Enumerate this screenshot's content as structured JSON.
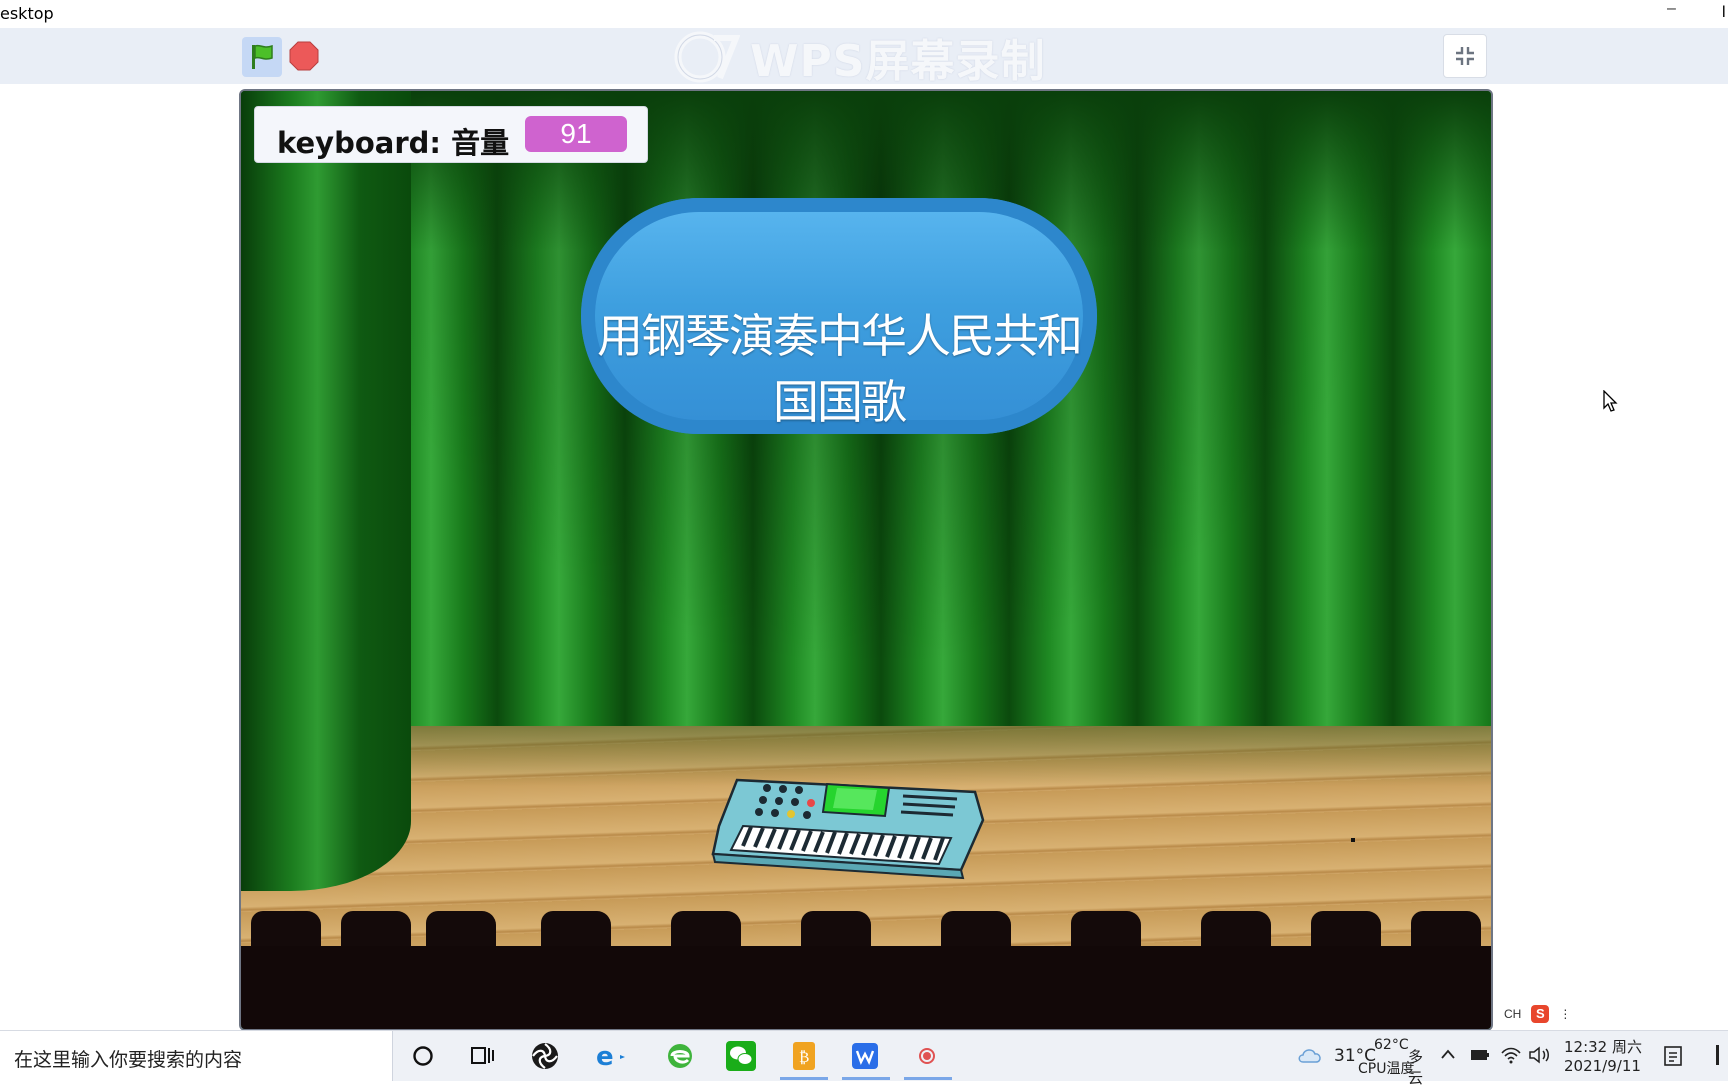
{
  "window": {
    "title": "esktop",
    "minimize_glyph": "–",
    "edge_glyph": "l"
  },
  "toolbar": {
    "green_flag_icon": "green-flag-icon",
    "stop_icon": "stop-sign-icon",
    "watermark": "WPS屏幕录制",
    "fullscreen_icon": "exit-fullscreen-icon"
  },
  "stage": {
    "monitor": {
      "label": "keyboard: 音量",
      "value": "91"
    },
    "title_sprite": "用钢琴演奏中华人民共和国国歌"
  },
  "ime": {
    "lang": "CH",
    "ime_logo": "S",
    "more": "⋮"
  },
  "taskbar": {
    "search_placeholder": "在这里输入你要搜索的内容",
    "weather": {
      "temp": "31°C",
      "cpu_temp": "62°C",
      "cpu_label": "CPU温度",
      "condition": "多云"
    },
    "clock": {
      "time": "12:32 周六",
      "date": "2021/9/11"
    },
    "icons": [
      "cortana-icon",
      "task-view-icon",
      "app-swirl-icon",
      "ie-browser-icon",
      "edge-browser-icon",
      "wechat-icon",
      "orange-app-icon",
      "wps-writer-icon",
      "screen-recorder-icon"
    ],
    "tray_icons": [
      "cloud-weather-icon",
      "chevron-up-icon",
      "battery-icon",
      "wifi-icon",
      "volume-icon",
      "notification-icon"
    ]
  },
  "colors": {
    "monitor_value_bg": "#cf63cf",
    "capsule_blue": "#3e9fdf",
    "curtain_green": "#1f8a23",
    "toolbar_bg": "#e9eef6"
  }
}
